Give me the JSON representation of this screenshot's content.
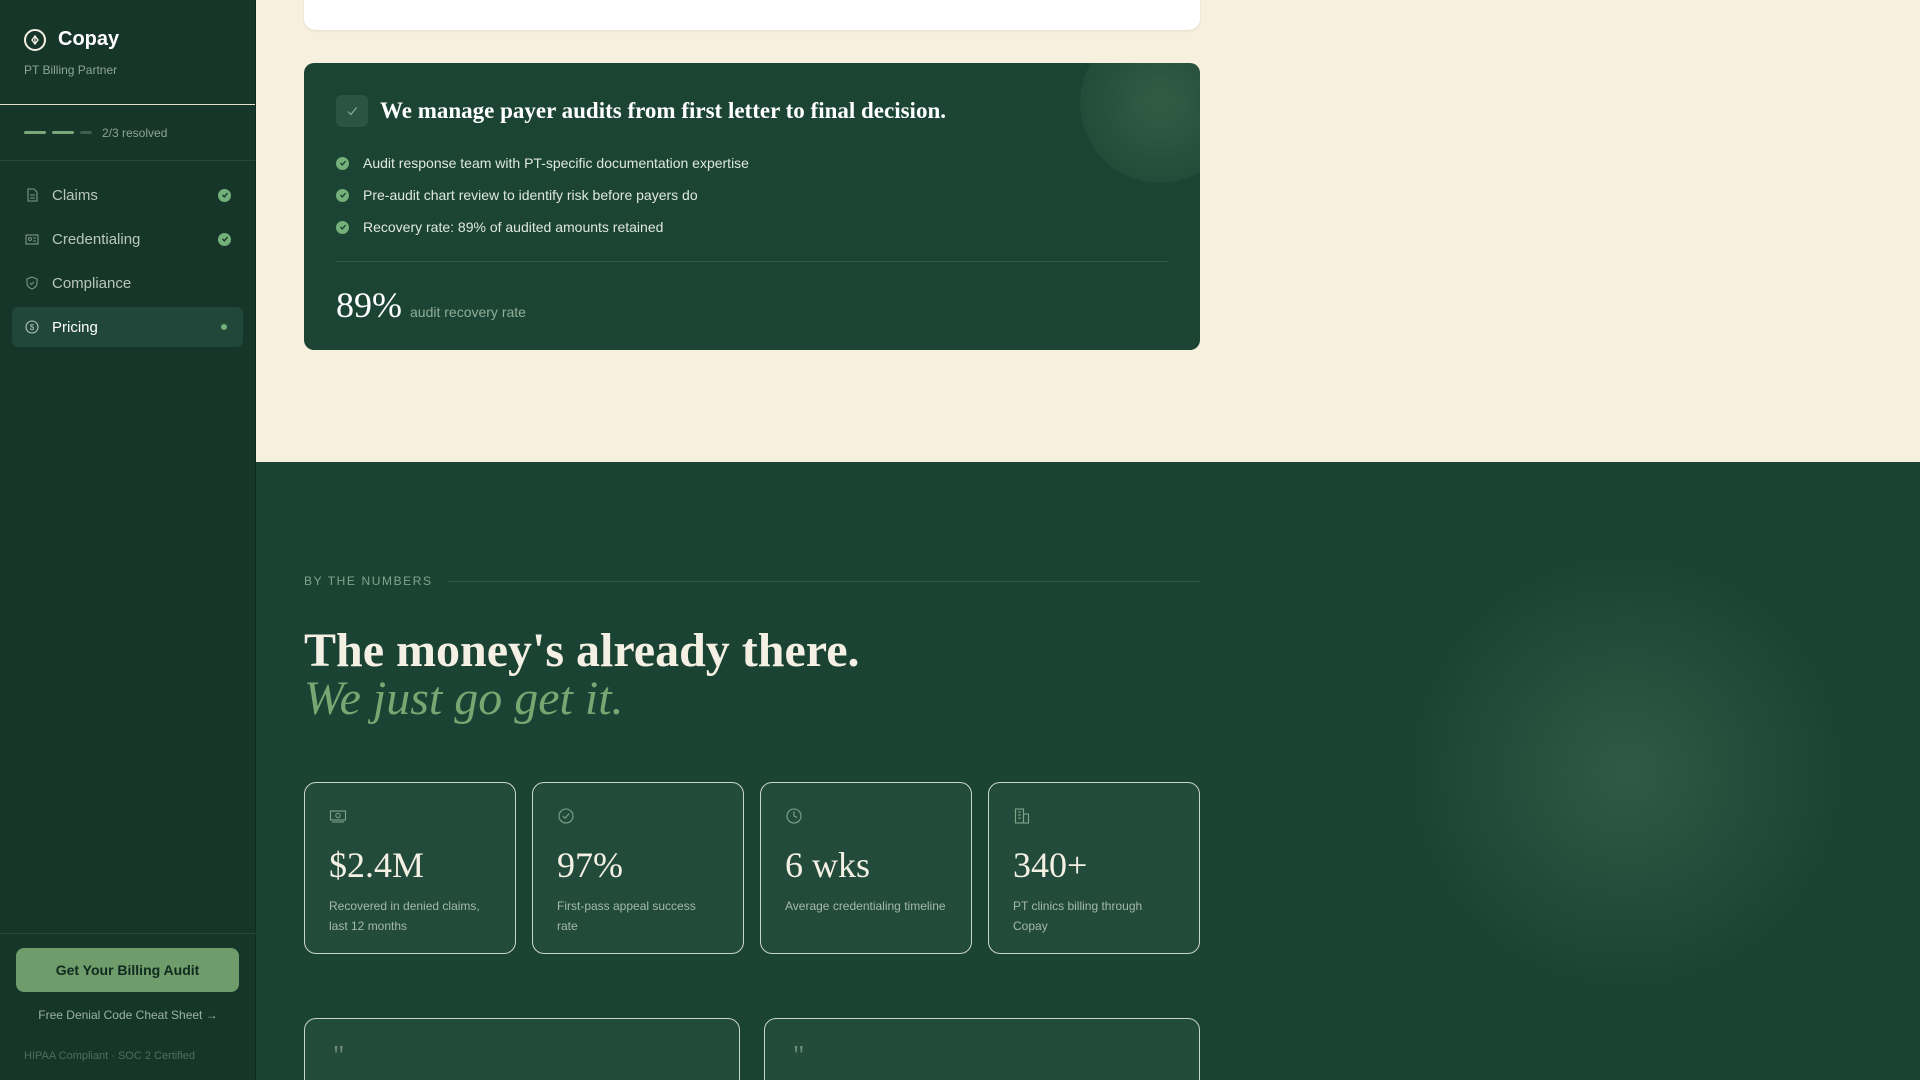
{
  "sidebar": {
    "brand": "Copay",
    "brand_sub": "PT Billing Partner",
    "progress_text": "2/3 resolved",
    "items": [
      {
        "label": "Claims",
        "icon": "document-icon",
        "status": "done"
      },
      {
        "label": "Credentialing",
        "icon": "id-card-icon",
        "status": "done"
      },
      {
        "label": "Compliance",
        "icon": "shield-icon",
        "status": "none"
      },
      {
        "label": "Pricing",
        "icon": "dollar-circle-icon",
        "status": "active"
      }
    ],
    "cta_label": "Get Your Billing Audit",
    "cta_link": "Free Denial Code Cheat Sheet →",
    "compliance": "HIPAA Compliant · SOC 2 Certified"
  },
  "audit": {
    "title": "We manage payer audits from first letter to final decision.",
    "bullets": [
      "Audit response team with PT-specific documentation expertise",
      "Pre-audit chart review to identify risk before payers do",
      "Recovery rate: 89% of audited amounts retained"
    ],
    "stat_value": "89%",
    "stat_caption": "audit recovery rate"
  },
  "numbers": {
    "eyebrow": "BY THE NUMBERS",
    "headline": "The money's already there.",
    "headline_em": "We just go get it.",
    "stats": [
      {
        "icon": "cash-icon",
        "value": "$2.4M",
        "label": "Recovered in denied claims, last 12 months"
      },
      {
        "icon": "check-circle-icon",
        "value": "97%",
        "label": "First-pass appeal success rate"
      },
      {
        "icon": "clock-icon",
        "value": "6 wks",
        "label": "Average credentialing timeline"
      },
      {
        "icon": "building-icon",
        "value": "340+",
        "label": "PT clinics billing through Copay"
      }
    ],
    "quote_mark": "\""
  },
  "colors": {
    "sidebar_bg": "#16362a",
    "accent_green": "#74b07a",
    "cream_bg": "#f8f0df",
    "section_bg": "#1b4334"
  }
}
